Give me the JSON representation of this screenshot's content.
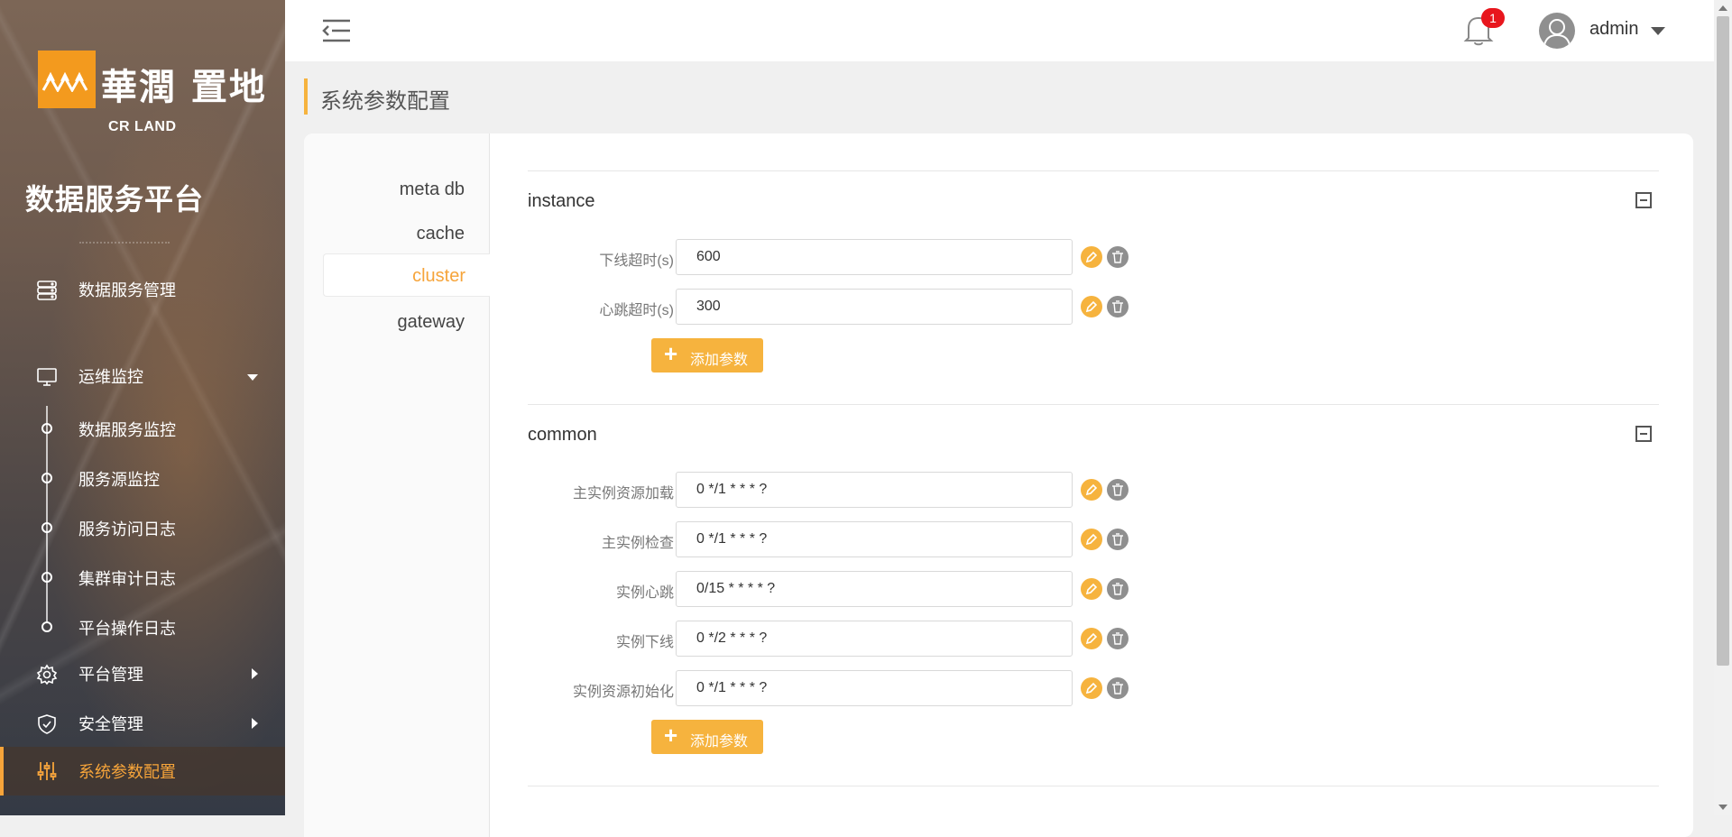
{
  "sidebar": {
    "logo_cn": "華潤 置地",
    "logo_en": "CR LAND",
    "platform_title": "数据服务平台",
    "menu": [
      {
        "label": "数据服务管理",
        "icon": "database-icon"
      },
      {
        "label": "运维监控",
        "icon": "monitor-icon",
        "expanded": true
      },
      {
        "label": "平台管理",
        "icon": "gear-icon"
      },
      {
        "label": "安全管理",
        "icon": "shield-check-icon"
      },
      {
        "label": "系统参数配置",
        "icon": "sliders-icon",
        "active": true
      }
    ],
    "submenu": [
      {
        "label": "数据服务监控"
      },
      {
        "label": "服务源监控"
      },
      {
        "label": "服务访问日志"
      },
      {
        "label": "集群审计日志"
      },
      {
        "label": "平台操作日志"
      }
    ]
  },
  "header": {
    "notification_count": "1",
    "username": "admin"
  },
  "page": {
    "title": "系统参数配置"
  },
  "tabs": [
    {
      "label": "meta db"
    },
    {
      "label": "cache"
    },
    {
      "label": "cluster",
      "active": true
    },
    {
      "label": "gateway"
    }
  ],
  "sections": [
    {
      "title": "instance",
      "params": [
        {
          "label": "下线超时(s)",
          "value": "600"
        },
        {
          "label": "心跳超时(s)",
          "value": "300"
        }
      ],
      "add_label": "添加参数"
    },
    {
      "title": "common",
      "params": [
        {
          "label": "主实例资源加载",
          "value": "0 */1 * * * ?"
        },
        {
          "label": "主实例检查",
          "value": "0 */1 * * * ?"
        },
        {
          "label": "实例心跳",
          "value": "0/15 * * * * ?"
        },
        {
          "label": "实例下线",
          "value": "0 */2 * * * ?"
        },
        {
          "label": "实例资源初始化",
          "value": "0 */1 * * * ?"
        }
      ],
      "add_label": "添加参数"
    }
  ],
  "colors": {
    "accent": "#f6a43a",
    "button": "#f6b33e",
    "badge": "#e8161d",
    "logo": "#f39a1e"
  }
}
